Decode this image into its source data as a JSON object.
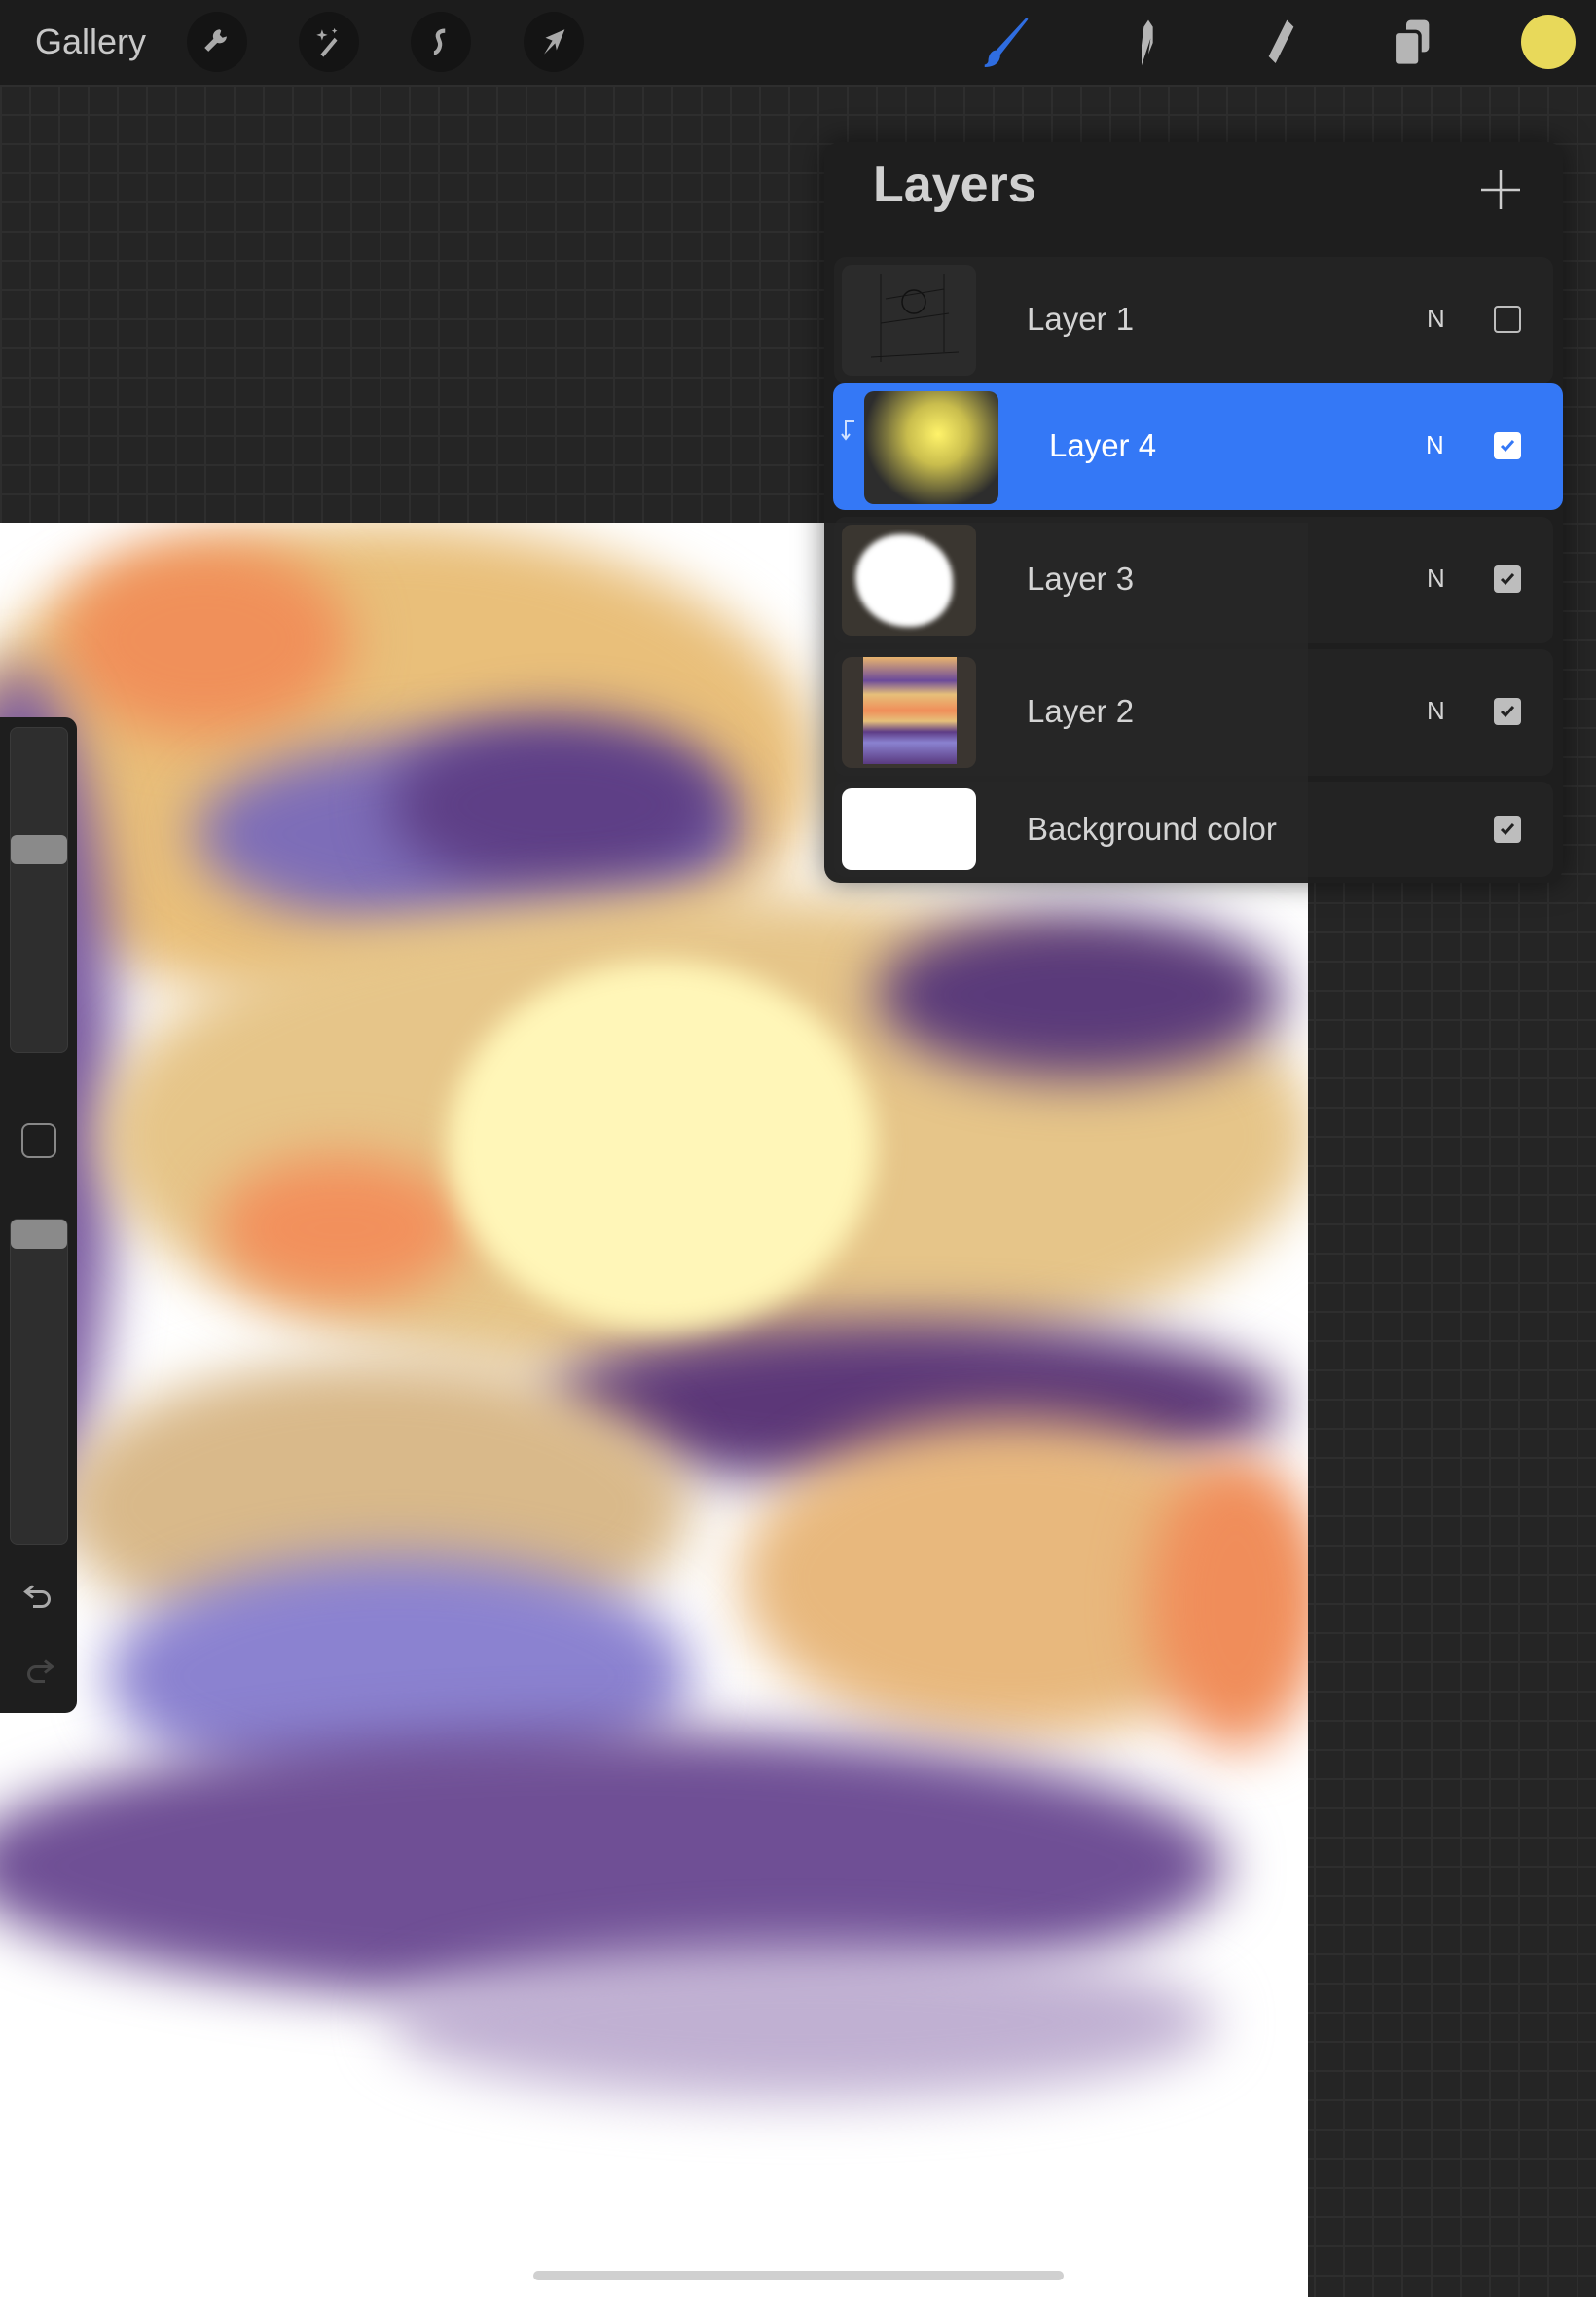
{
  "toolbar": {
    "gallery_label": "Gallery",
    "left_tools": [
      "wrench-icon",
      "magic-wand-icon",
      "selection-icon",
      "transform-arrow-icon"
    ],
    "right_tools": [
      "brush-icon",
      "smudge-icon",
      "eraser-icon",
      "layers-icon"
    ],
    "active_tool": "brush",
    "accent_color": "#3478f6",
    "current_color": "#e8d95a"
  },
  "layers_panel": {
    "title": "Layers",
    "layers": [
      {
        "name": "Layer 1",
        "mode": "N",
        "visible": false,
        "selected": false
      },
      {
        "name": "Layer 4",
        "mode": "N",
        "visible": true,
        "selected": true,
        "clipping_mask": true
      },
      {
        "name": "Layer 3",
        "mode": "N",
        "visible": true,
        "selected": false
      },
      {
        "name": "Layer 2",
        "mode": "N",
        "visible": true,
        "selected": false
      },
      {
        "name": "Background color",
        "visible": true,
        "selected": false
      }
    ]
  },
  "sidebar": {
    "brush_size": 0.72,
    "opacity": 0.96
  }
}
